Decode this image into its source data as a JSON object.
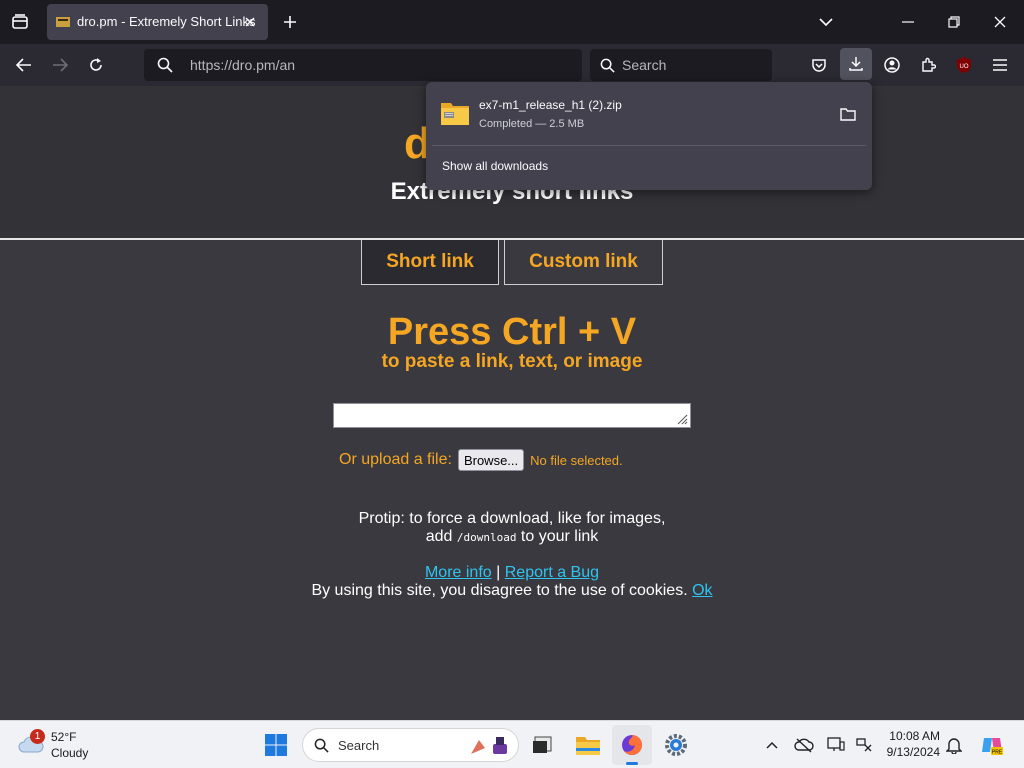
{
  "browser": {
    "tab_title": "dro.pm - Extremely Short Links",
    "url": "https://dro.pm/an",
    "search_placeholder": "Search"
  },
  "page": {
    "logo_visible": "d",
    "subtitle": "Extremely short links",
    "tab_short": "Short link",
    "tab_custom": "Custom link",
    "headline": "Press Ctrl + V",
    "headline_sub": "to paste a link, text, or image",
    "upload_label": "Or upload a file:",
    "browse_label": "Browse...",
    "no_file": "No file selected.",
    "protip_line1": "Protip: to force a download, like for images,",
    "protip_add": "add",
    "protip_code": "/download",
    "protip_end": "to your link",
    "more_info": "More info",
    "separator": "|",
    "report_bug": "Report a Bug",
    "cookie_text": "By using this site, you disagree to the use of cookies.",
    "cookie_ok": "Ok",
    "accent_color": "#f5a623",
    "link_color": "#2ec4f0"
  },
  "downloads": {
    "file_name": "ex7-m1_release_h1 (2).zip",
    "status": "Completed — 2.5 MB",
    "show_all": "Show all downloads"
  },
  "taskbar": {
    "weather_badge": "1",
    "temperature": "52°F",
    "condition": "Cloudy",
    "search_placeholder": "Search",
    "time": "10:08 AM",
    "date": "9/13/2024"
  }
}
